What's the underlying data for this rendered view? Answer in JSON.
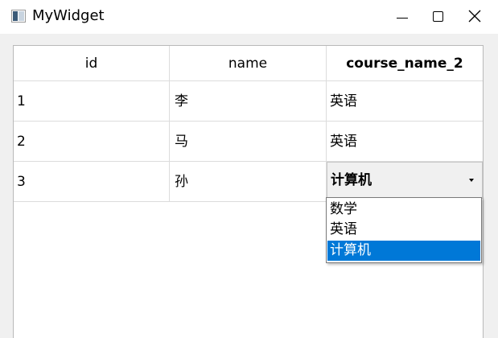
{
  "window": {
    "title": "MyWidget",
    "icons": {
      "app": "app-window-icon",
      "minimize": "minimize-icon",
      "maximize": "maximize-icon",
      "close": "close-icon"
    }
  },
  "table": {
    "headers": [
      "id",
      "name",
      "course_name_2"
    ],
    "rows": [
      [
        "1",
        "李",
        "英语"
      ],
      [
        "2",
        "马",
        "英语"
      ],
      [
        "3",
        "孙",
        "计算机"
      ]
    ]
  },
  "editor": {
    "current_value": "计算机",
    "options": [
      "数学",
      "英语",
      "计算机"
    ],
    "selected_index": 2,
    "selection_color": "#0078d7"
  }
}
